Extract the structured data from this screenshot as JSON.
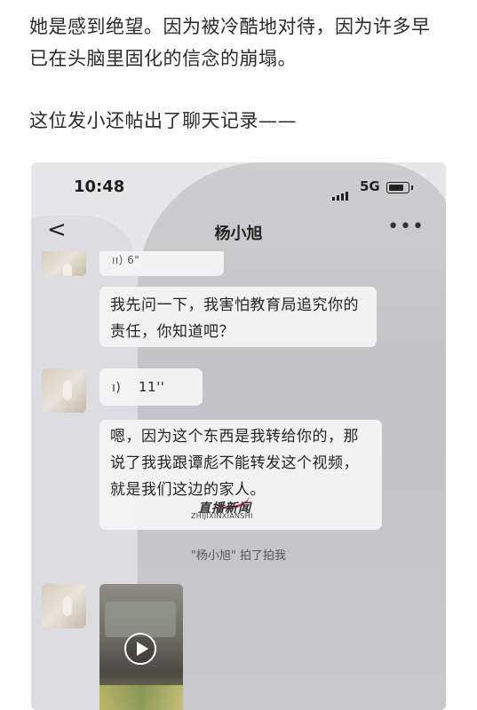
{
  "article": {
    "paragraph_1": "她是感到绝望。因为被冷酷地对待，因为许多早已在头脑里固化的信念的崩塌。",
    "paragraph_2": "这位发小还帖出了聊天记录——"
  },
  "screenshot": {
    "status_bar": {
      "time": "10:48",
      "network": "5G"
    },
    "nav": {
      "back_glyph": "<",
      "title": "杨小旭",
      "more_glyph": "•••"
    },
    "messages": [
      {
        "type": "voice",
        "text": "ıı) 6\""
      },
      {
        "type": "text",
        "text": "我先问一下，我害怕教育局追究你的责任，你知道吧？"
      },
      {
        "type": "voice",
        "icon": "ı)",
        "duration": "11''"
      },
      {
        "type": "text",
        "text": "嗯，因为这个东西是我转给你的，那说了我我跟谭彪不能转发这个视频，就是我们这边的家人。"
      }
    ],
    "system_notice": "\"杨小旭\" 拍了拍我",
    "watermark": {
      "cn": "直播新闻",
      "en": "ZHIJIXINXIANSHI"
    }
  },
  "icons": [
    "signal-icon",
    "battery-icon",
    "back-icon",
    "more-icon",
    "voice-icon",
    "play-icon"
  ]
}
